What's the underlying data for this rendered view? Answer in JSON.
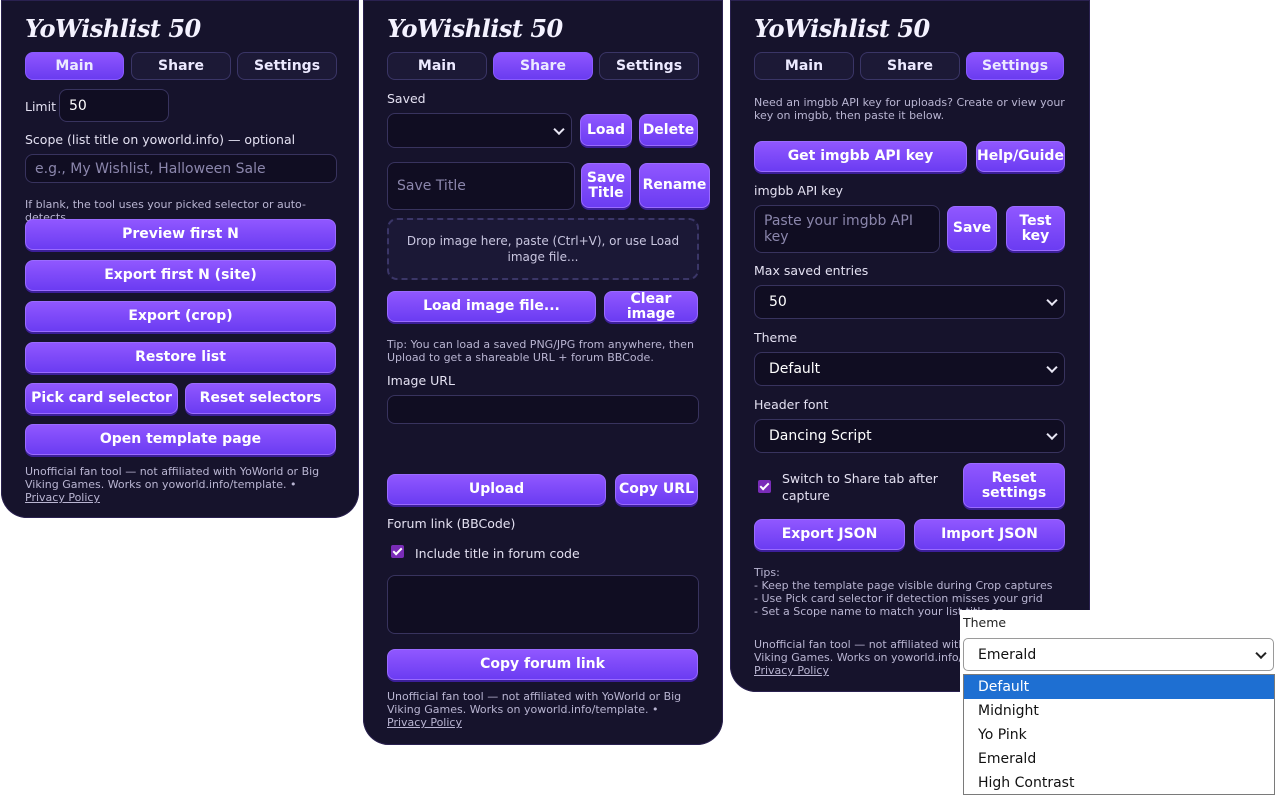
{
  "app_title": "YoWishlist 50",
  "tabs": [
    "Main",
    "Share",
    "Settings"
  ],
  "main": {
    "limit_label": "Limit",
    "limit_value": "50",
    "scope_label": "Scope (list title on yoworld.info) — optional",
    "scope_placeholder": "e.g., My Wishlist, Halloween Sale",
    "scope_hint": "If blank, the tool uses your picked selector or auto-detects.",
    "buttons": {
      "preview": "Preview first N",
      "export_site": "Export first N (site)",
      "export_crop": "Export (crop)",
      "restore": "Restore list",
      "pick_selector": "Pick card selector",
      "reset_selectors": "Reset selectors",
      "open_template": "Open template page"
    }
  },
  "share": {
    "saved_label": "Saved",
    "load": "Load",
    "delete": "Delete",
    "save_title_placeholder": "Save Title",
    "save_title": "Save Title",
    "rename": "Rename",
    "dropzone": "Drop image here, paste (Ctrl+V), or use Load image file...",
    "load_image": "Load image file...",
    "clear_image": "Clear image",
    "tip": "Tip: You can load a saved PNG/JPG from anywhere, then Upload to get a shareable URL + forum BBCode.",
    "image_url_label": "Image URL",
    "upload": "Upload",
    "copy_url": "Copy URL",
    "forum_label": "Forum link (BBCode)",
    "include_title": "Include title in forum code",
    "copy_forum": "Copy forum link"
  },
  "settings": {
    "intro": "Need an imgbb API key for uploads? Create or view your key on imgbb, then paste it below.",
    "get_key": "Get imgbb API key",
    "help": "Help/Guide",
    "api_label": "imgbb API key",
    "api_placeholder": "Paste your imgbb API key",
    "save": "Save",
    "test_key": "Test key",
    "max_label": "Max saved entries",
    "max_value": "50",
    "theme_label": "Theme",
    "theme_value": "Default",
    "font_label": "Header font",
    "font_value": "Dancing Script",
    "switch_share": "Switch to Share tab after capture",
    "reset_settings": "Reset settings",
    "export_json": "Export JSON",
    "import_json": "Import JSON",
    "tips_header": "Tips:",
    "tips": [
      "- Keep the template page visible during Crop captures",
      "- Use Pick card selector if detection misses your grid",
      "- Set a Scope name to match your list title on..."
    ]
  },
  "footer": {
    "text": "Unofficial fan tool — not affiliated with YoWorld or Big Viking Games. Works on yoworld.info/template. • ",
    "link": "Privacy Policy"
  },
  "theme_dropdown": {
    "label": "Theme",
    "current": "Emerald",
    "options": [
      "Default",
      "Midnight",
      "Yo Pink",
      "Emerald",
      "High Contrast"
    ],
    "highlighted": "Default"
  }
}
